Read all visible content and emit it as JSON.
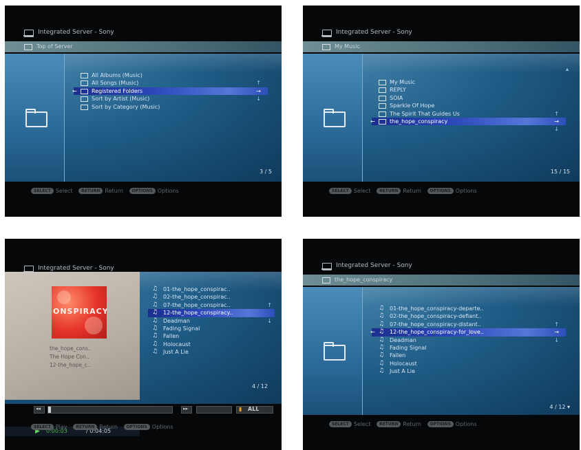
{
  "screens": [
    {
      "header": "Integrated Server - Sony",
      "breadcrumb": "Top of Server",
      "items": [
        {
          "label": "All Albums (Music)"
        },
        {
          "label": "All Songs (Music)"
        },
        {
          "label": "Registered Folders",
          "selected": true
        },
        {
          "label": "Sort by Artist (Music)"
        },
        {
          "label": "Sort by Category (Music)"
        }
      ],
      "counter": "3 / 5",
      "footer": [
        {
          "key": "SELECT",
          "label": "Select"
        },
        {
          "key": "RETURN",
          "label": "Return"
        },
        {
          "key": "OPTIONS",
          "label": "Options"
        }
      ]
    },
    {
      "header": "Integrated Server - Sony",
      "breadcrumb": "My Music",
      "items": [
        {
          "label": "My Music"
        },
        {
          "label": "REPLY"
        },
        {
          "label": "SOIA"
        },
        {
          "label": "Sparkle Of Hope"
        },
        {
          "label": "The Spirit That Guides Us"
        },
        {
          "label": "the_hope_conspiracy",
          "selected": true
        }
      ],
      "counter": "15 / 15",
      "footer": [
        {
          "key": "SELECT",
          "label": "Select"
        },
        {
          "key": "RETURN",
          "label": "Return"
        },
        {
          "key": "OPTIONS",
          "label": "Options"
        }
      ]
    },
    {
      "header": "Integrated Server - Sony",
      "album": {
        "cover_text": "ONSPIRACY",
        "artist": "the_hope_cons..",
        "album": "The Hope Con..",
        "track": "12-the_hope_c.."
      },
      "items": [
        {
          "label": "01-the_hope_conspirac.."
        },
        {
          "label": "02-the_hope_conspirac.."
        },
        {
          "label": "07-the_hope_conspirac.."
        },
        {
          "label": "12-the_hope_conspiracy..",
          "selected": true
        },
        {
          "label": "Deadman"
        },
        {
          "label": "Fading Signal"
        },
        {
          "label": "Fallen"
        },
        {
          "label": "Holocaust"
        },
        {
          "label": "Just A Lie"
        }
      ],
      "counter": "4 / 12",
      "time_elapsed": "0:00:03",
      "time_total": "/ 0:04:05",
      "repeat": "ALL",
      "footer": [
        {
          "key": "SELECT",
          "label": "Play"
        },
        {
          "key": "RETURN",
          "label": "Return"
        },
        {
          "key": "OPTIONS",
          "label": "Options"
        }
      ]
    },
    {
      "header": "Integrated Server - Sony",
      "breadcrumb": "the_hope_conspiracy",
      "items": [
        {
          "label": "01-the_hope_conspiracy-departe.."
        },
        {
          "label": "02-the_hope_conspiracy-defiant.."
        },
        {
          "label": "07-the_hope_conspiracy-distant.."
        },
        {
          "label": "12-the_hope_conspiracy-for_love..",
          "selected": true
        },
        {
          "label": "Deadman"
        },
        {
          "label": "Fading Signal"
        },
        {
          "label": "Fallen"
        },
        {
          "label": "Holocaust"
        },
        {
          "label": "Just A Lie"
        }
      ],
      "counter": "4 / 12 ▾",
      "footer": [
        {
          "key": "SELECT",
          "label": "Select"
        },
        {
          "key": "RETURN",
          "label": "Return"
        },
        {
          "key": "OPTIONS",
          "label": "Options"
        }
      ]
    }
  ]
}
